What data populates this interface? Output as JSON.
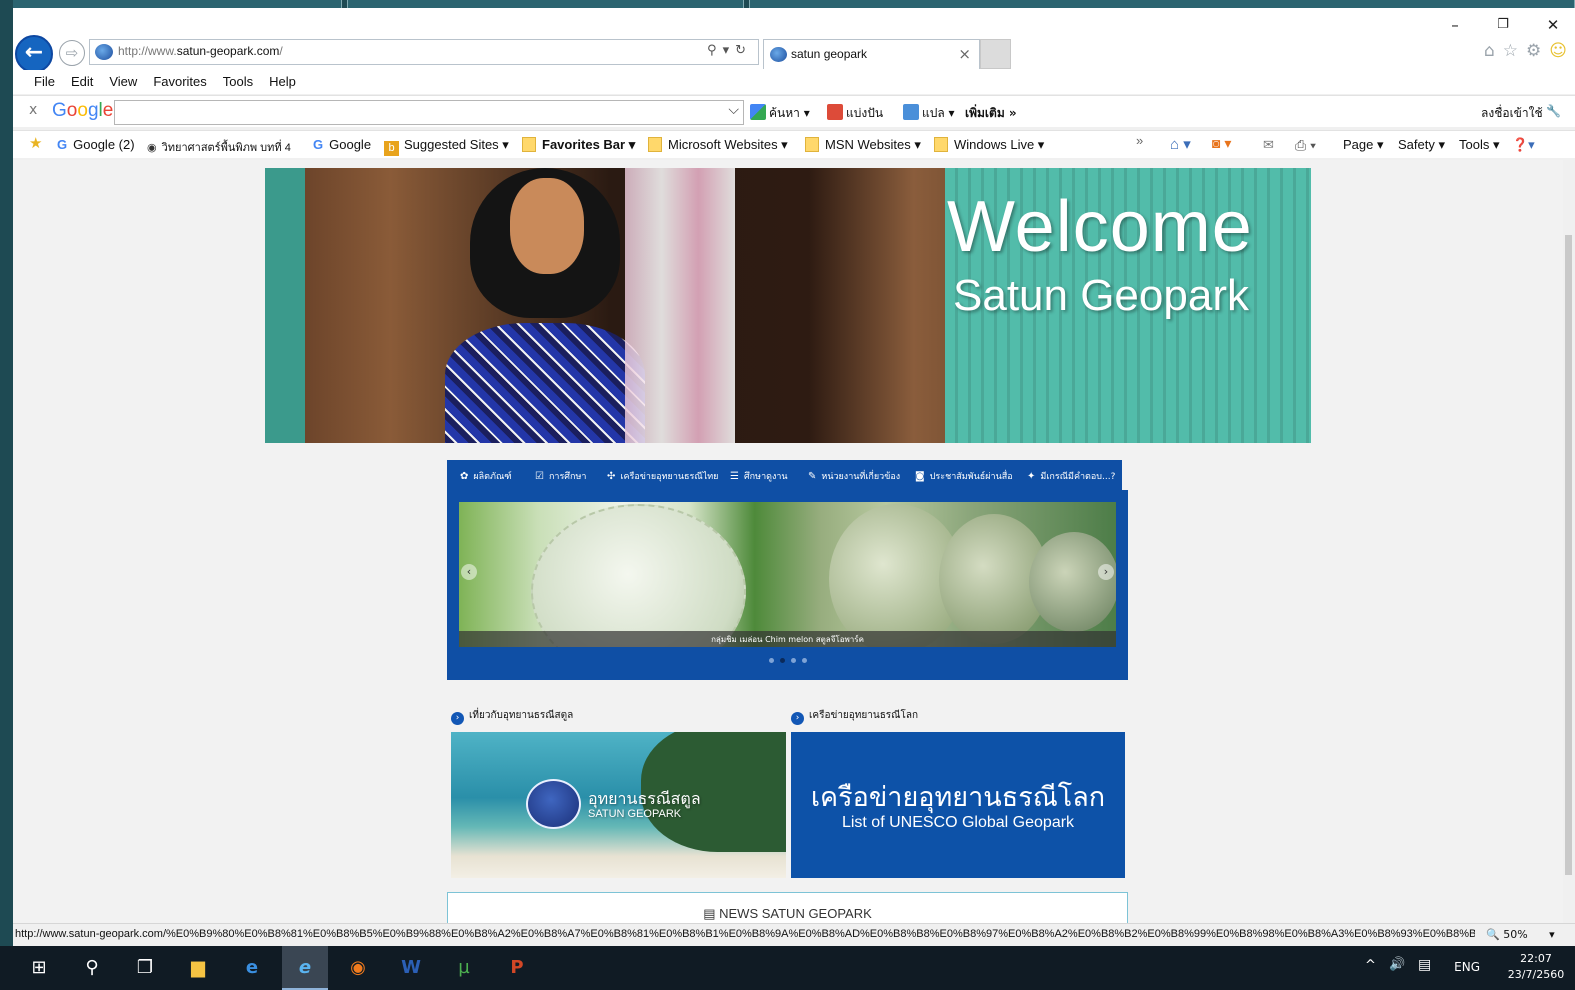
{
  "window": {
    "minimize": "–",
    "restore": "❐",
    "close": "✕"
  },
  "address_bar": {
    "url_prefix": "http://www.",
    "url_domain": "satun-geopark.com",
    "url_suffix": "/"
  },
  "tab": {
    "title": "satun geopark",
    "close": "×"
  },
  "menu": [
    "File",
    "Edit",
    "View",
    "Favorites",
    "Tools",
    "Help"
  ],
  "google_toolbar": {
    "close": "x",
    "search_value": "",
    "search_label": "ค้นหา ▾",
    "share_label": "แบ่งปัน",
    "translate_label": "แปล ▾",
    "more_label": "เพิ่มเติม »",
    "signin_label": "ลงชื่อเข้าใช้"
  },
  "favorites_bar": {
    "items": [
      "Google (2)",
      "วิทยาศาสตร์พื้นพิภพ บทที่ 4",
      "Google",
      "Suggested Sites ▾",
      "Favorites Bar ▾",
      "Microsoft Websites ▾",
      "MSN Websites ▾",
      "Windows Live ▾"
    ],
    "overflow": "»"
  },
  "command_bar": [
    "Page ▾",
    "Safety ▾",
    "Tools ▾"
  ],
  "hero": {
    "title": "Welcome",
    "subtitle": "Satun Geopark"
  },
  "site_nav": [
    {
      "icon": "✿",
      "label": "ผลิตภัณฑ์"
    },
    {
      "icon": "☑",
      "label": "การศึกษา"
    },
    {
      "icon": "✣",
      "label": "เครือข่ายอุทยานธรณีไทย"
    },
    {
      "icon": "☰",
      "label": "ศึกษาดูงาน"
    },
    {
      "icon": "✎",
      "label": "หน่วยงานที่เกี่ยวข้อง"
    },
    {
      "icon": "◙",
      "label": "ประชาสัมพันธ์ผ่านสื่อ"
    },
    {
      "icon": "✦",
      "label": "มีเกรณีมีคำตอบ...?"
    }
  ],
  "slider": {
    "caption": "กลุ่มชิม เมล่อน Chim melon สตูลจีโอพาร์ค",
    "dots_total": 4,
    "dot_active": 2
  },
  "sections": {
    "left_heading": "เที่ยวกับอุทยานธรณีสตูล",
    "right_heading": "เครือข่ายอุทยานธรณีโลก"
  },
  "cards": {
    "satun_th": "อุทยานธรณีสตูล",
    "satun_en": "SATUN GEOPARK",
    "unesco_th": "เครือข่ายอุทยานธรณีโลก",
    "unesco_en": "List of UNESCO Global Geopark"
  },
  "news": {
    "title": "NEWS SATUN GEOPARK"
  },
  "status_bar": {
    "url": "http://www.satun-geopark.com/%E0%B9%80%E0%B8%81%E0%B8%B5%E0%B9%88%E0%B8%A2%E0%B8%A7%E0%B8%81%E0%B8%B1%E0%B8%9A%E0%B8%AD%E0%B8%B8%E0%B8%97%E0%B8%A2%E0%B8%B2%E0%B8%99%E0%B8%98%E0%B8%A3%E0%B8%93%E0%B8%B5%E0%B8%AA%E0%B8%95%E0%B8%B9%E0%B8%A5",
    "zoom": "50%"
  },
  "taskbar": {
    "language": "ENG",
    "time": "22:07",
    "date": "23/7/2560"
  }
}
